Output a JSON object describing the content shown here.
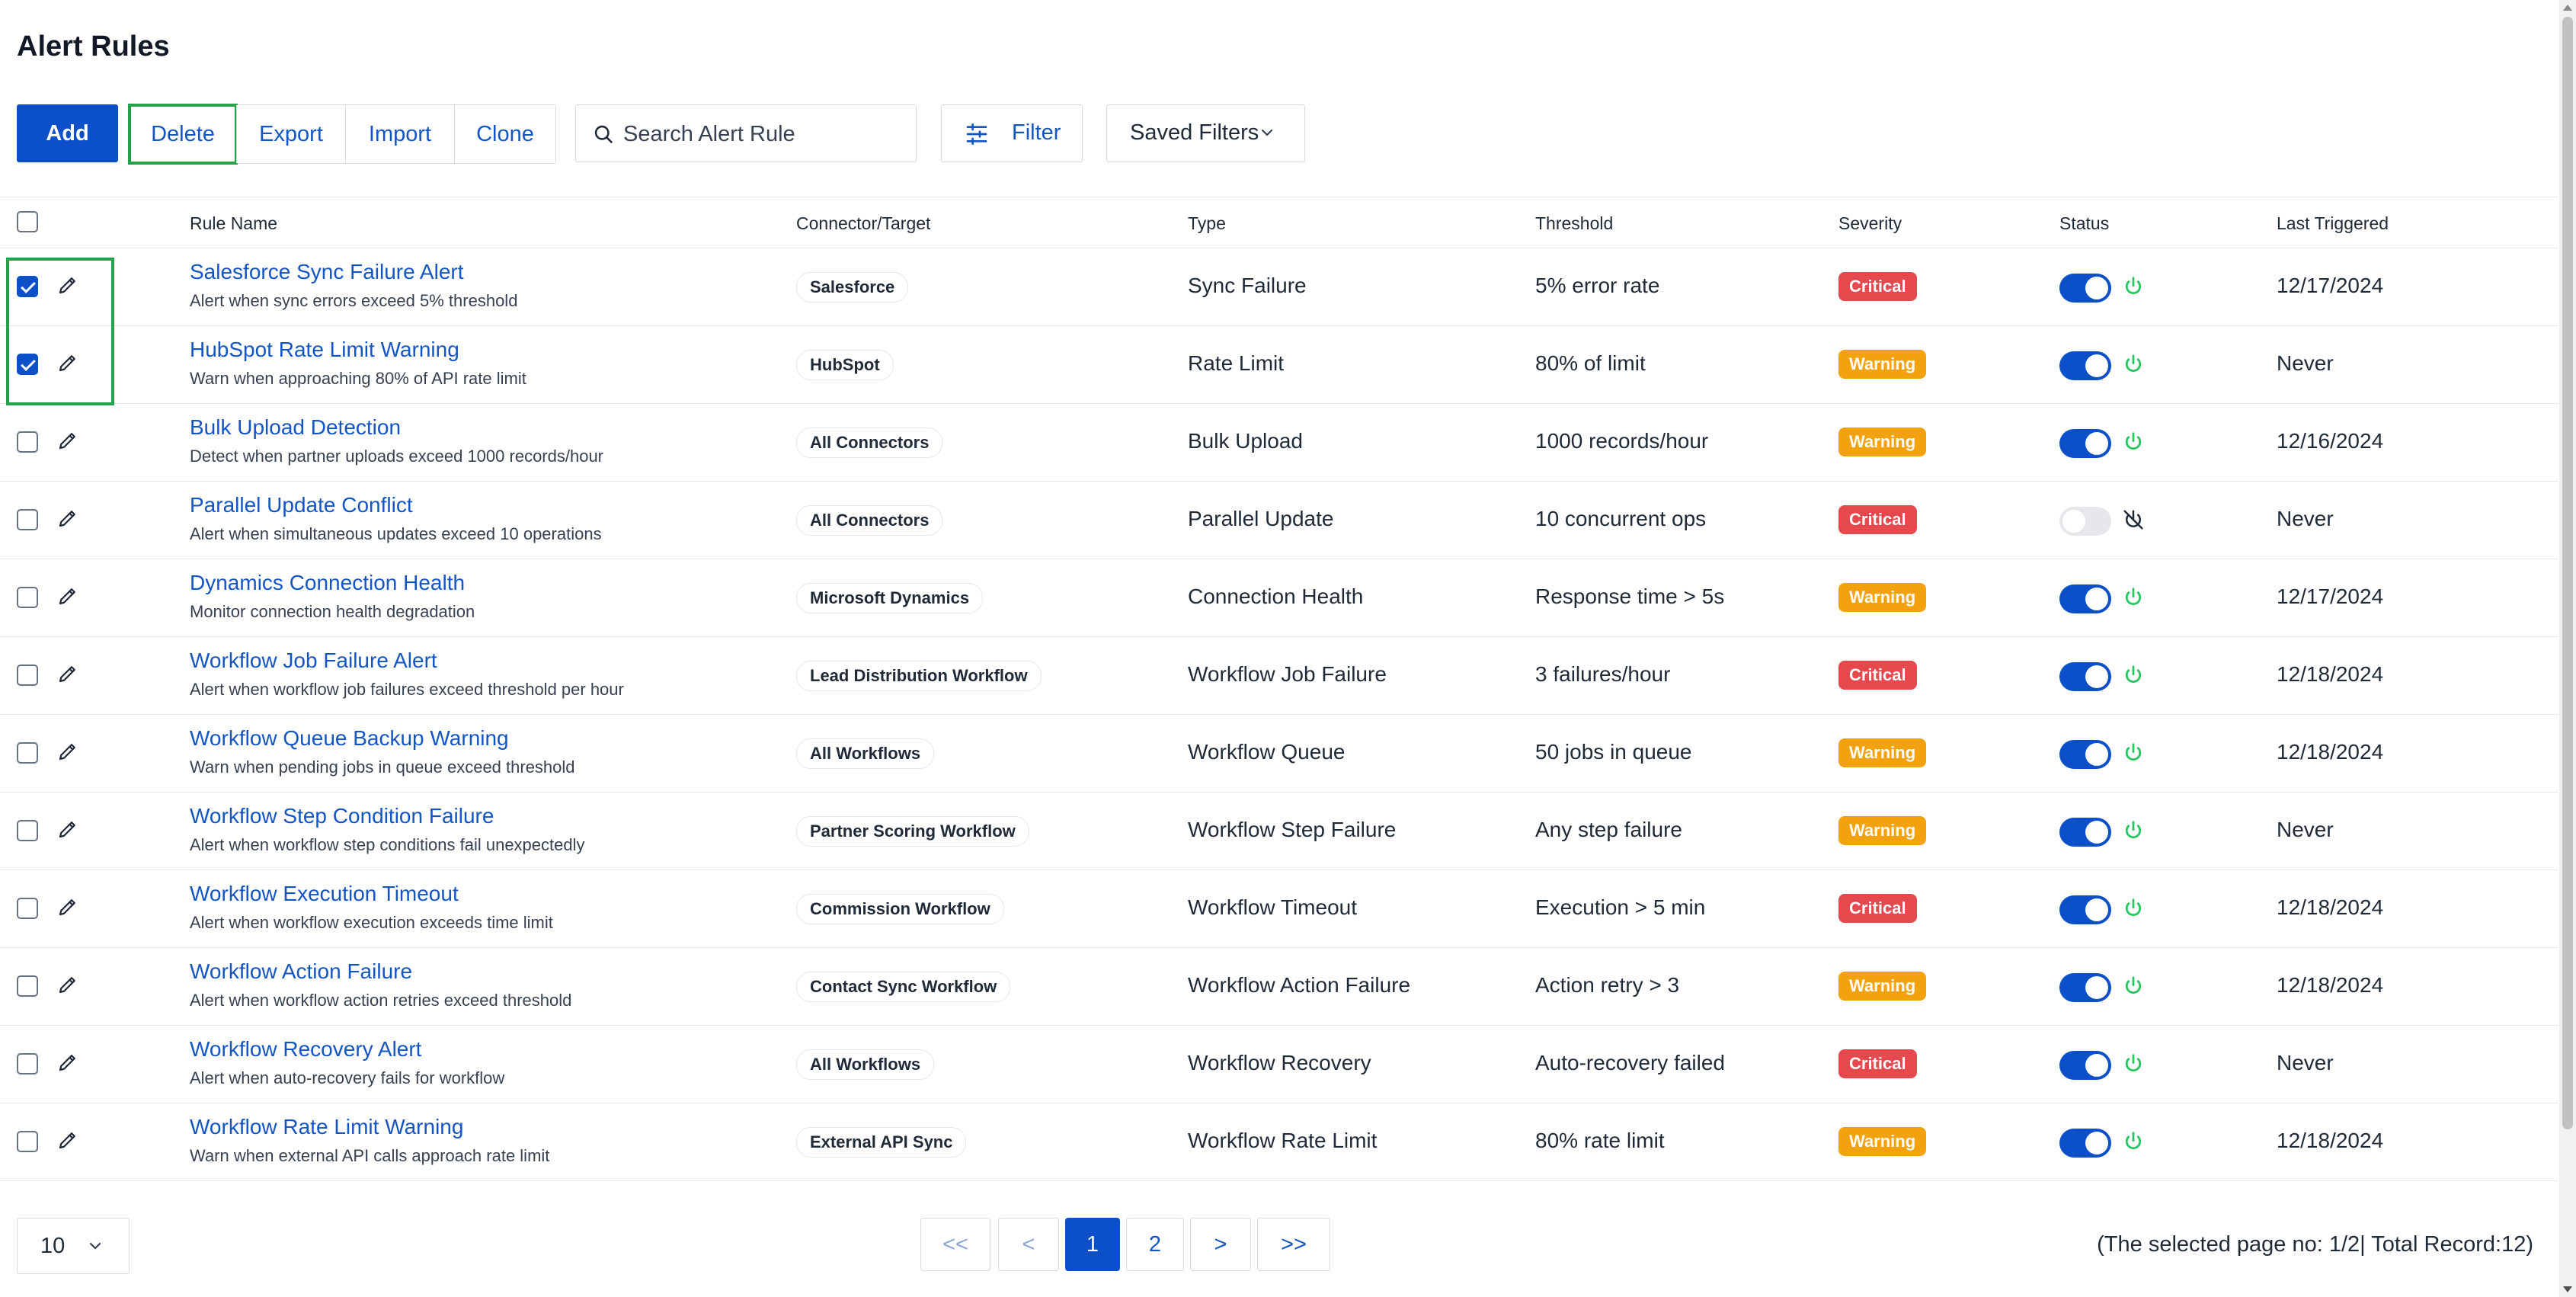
{
  "page": {
    "title": "Alert Rules"
  },
  "toolbar": {
    "add_label": "Add",
    "delete_label": "Delete",
    "export_label": "Export",
    "import_label": "Import",
    "clone_label": "Clone",
    "search_placeholder": "Search Alert Rule",
    "filter_label": "Filter",
    "saved_filters_label": "Saved Filters"
  },
  "table": {
    "columns": [
      "Rule Name",
      "Connector/Target",
      "Type",
      "Threshold",
      "Severity",
      "Status",
      "Last Triggered"
    ],
    "rows": [
      {
        "checked": true,
        "name": "Salesforce Sync Failure Alert",
        "desc": "Alert when sync errors exceed 5% threshold",
        "connector": "Salesforce",
        "type": "Sync Failure",
        "threshold": "5% error rate",
        "severity": "Critical",
        "enabled": true,
        "last": "12/17/2024"
      },
      {
        "checked": true,
        "name": "HubSpot Rate Limit Warning",
        "desc": "Warn when approaching 80% of API rate limit",
        "connector": "HubSpot",
        "type": "Rate Limit",
        "threshold": "80% of limit",
        "severity": "Warning",
        "enabled": true,
        "last": "Never"
      },
      {
        "checked": false,
        "name": "Bulk Upload Detection",
        "desc": "Detect when partner uploads exceed 1000 records/hour",
        "connector": "All Connectors",
        "type": "Bulk Upload",
        "threshold": "1000 records/hour",
        "severity": "Warning",
        "enabled": true,
        "last": "12/16/2024"
      },
      {
        "checked": false,
        "name": "Parallel Update Conflict",
        "desc": "Alert when simultaneous updates exceed 10 operations",
        "connector": "All Connectors",
        "type": "Parallel Update",
        "threshold": "10 concurrent ops",
        "severity": "Critical",
        "enabled": false,
        "last": "Never"
      },
      {
        "checked": false,
        "name": "Dynamics Connection Health",
        "desc": "Monitor connection health degradation",
        "connector": "Microsoft Dynamics",
        "type": "Connection Health",
        "threshold": "Response time > 5s",
        "severity": "Warning",
        "enabled": true,
        "last": "12/17/2024"
      },
      {
        "checked": false,
        "name": "Workflow Job Failure Alert",
        "desc": "Alert when workflow job failures exceed threshold per hour",
        "connector": "Lead Distribution Workflow",
        "type": "Workflow Job Failure",
        "threshold": "3 failures/hour",
        "severity": "Critical",
        "enabled": true,
        "last": "12/18/2024"
      },
      {
        "checked": false,
        "name": "Workflow Queue Backup Warning",
        "desc": "Warn when pending jobs in queue exceed threshold",
        "connector": "All Workflows",
        "type": "Workflow Queue",
        "threshold": "50 jobs in queue",
        "severity": "Warning",
        "enabled": true,
        "last": "12/18/2024"
      },
      {
        "checked": false,
        "name": "Workflow Step Condition Failure",
        "desc": "Alert when workflow step conditions fail unexpectedly",
        "connector": "Partner Scoring Workflow",
        "type": "Workflow Step Failure",
        "threshold": "Any step failure",
        "severity": "Warning",
        "enabled": true,
        "last": "Never"
      },
      {
        "checked": false,
        "name": "Workflow Execution Timeout",
        "desc": "Alert when workflow execution exceeds time limit",
        "connector": "Commission Workflow",
        "type": "Workflow Timeout",
        "threshold": "Execution > 5 min",
        "severity": "Critical",
        "enabled": true,
        "last": "12/18/2024"
      },
      {
        "checked": false,
        "name": "Workflow Action Failure",
        "desc": "Alert when workflow action retries exceed threshold",
        "connector": "Contact Sync Workflow",
        "type": "Workflow Action Failure",
        "threshold": "Action retry > 3",
        "severity": "Warning",
        "enabled": true,
        "last": "12/18/2024"
      },
      {
        "checked": false,
        "name": "Workflow Recovery Alert",
        "desc": "Alert when auto-recovery fails for workflow",
        "connector": "All Workflows",
        "type": "Workflow Recovery",
        "threshold": "Auto-recovery failed",
        "severity": "Critical",
        "enabled": true,
        "last": "Never"
      },
      {
        "checked": false,
        "name": "Workflow Rate Limit Warning",
        "desc": "Warn when external API calls approach rate limit",
        "connector": "External API Sync",
        "type": "Workflow Rate Limit",
        "threshold": "80% rate limit",
        "severity": "Warning",
        "enabled": true,
        "last": "12/18/2024"
      }
    ]
  },
  "pagination": {
    "page_size": "10",
    "first": "<<",
    "prev": "<",
    "pages": [
      "1",
      "2"
    ],
    "current_page": "1",
    "next": ">",
    "last": ">>",
    "info": "(The selected page no: 1/2| Total Record:12)"
  },
  "colors": {
    "primary": "#0b4fc9",
    "link": "#1455c4",
    "critical": "#e5484d",
    "warning": "#f2a20f",
    "status_on_icon": "#22c55e",
    "highlight": "#22a34a"
  },
  "icons": {
    "edit": "pencil-icon",
    "search": "search-icon",
    "filter": "sliders-icon",
    "dropdown": "chevron-down-icon",
    "status_on": "power-icon",
    "status_off": "power-off-icon"
  }
}
